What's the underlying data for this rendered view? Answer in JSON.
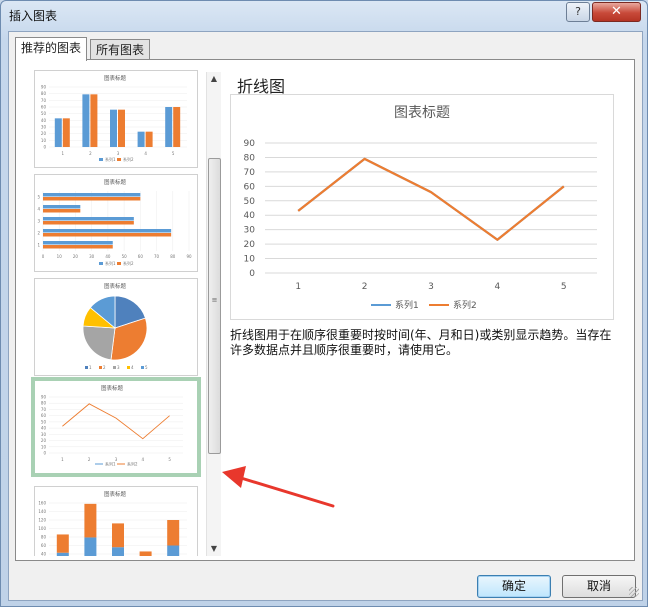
{
  "dialog": {
    "title": "插入图表",
    "help_label": "?",
    "close_label": "✕"
  },
  "tabs": [
    {
      "label": "推荐的图表",
      "active": true
    },
    {
      "label": "所有图表",
      "active": false
    }
  ],
  "thumbnails": [
    {
      "type": "clustered-column",
      "title": "图表标题",
      "y_ticks": [
        "0",
        "10",
        "20",
        "30",
        "40",
        "50",
        "60",
        "70",
        "80",
        "90"
      ],
      "categories": [
        "1",
        "2",
        "3",
        "4",
        "5"
      ],
      "series": [
        {
          "name": "系列1",
          "values": [
            43,
            79,
            56,
            23,
            60
          ]
        },
        {
          "name": "系列2",
          "values": [
            43,
            79,
            56,
            23,
            60
          ]
        }
      ],
      "legend": [
        "系列1",
        "系列2"
      ]
    },
    {
      "type": "clustered-bar",
      "title": "图表标题",
      "x_ticks": [
        "0",
        "10",
        "20",
        "30",
        "40",
        "50",
        "60",
        "70",
        "80",
        "90"
      ],
      "categories": [
        "1",
        "2",
        "3",
        "4",
        "5"
      ],
      "series": [
        {
          "name": "系列1",
          "values": [
            43,
            79,
            56,
            23,
            60
          ]
        },
        {
          "name": "系列2",
          "values": [
            43,
            79,
            56,
            23,
            60
          ]
        }
      ],
      "legend": [
        "系列1",
        "系列2"
      ]
    },
    {
      "type": "pie",
      "title": "图表标题",
      "values": [
        20,
        32,
        24,
        10,
        14
      ],
      "colors": [
        "#4f81bd",
        "#ed7d31",
        "#a5a5a5",
        "#ffc000",
        "#5b9bd5"
      ],
      "legend": [
        "1",
        "2",
        "3",
        "4",
        "5"
      ]
    },
    {
      "type": "line",
      "title": "图表标题",
      "y_ticks": [
        "0",
        "10",
        "20",
        "30",
        "40",
        "50",
        "60",
        "70",
        "80",
        "90"
      ],
      "categories": [
        "1",
        "2",
        "3",
        "4",
        "5"
      ],
      "values": [
        43,
        79,
        56,
        23,
        60
      ],
      "legend": [
        "系列1",
        "系列2"
      ],
      "selected": true
    },
    {
      "type": "stacked-column",
      "title": "图表标题",
      "y_ticks": [
        "0",
        "20",
        "40",
        "60",
        "80",
        "100",
        "120",
        "140",
        "160"
      ],
      "categories": [
        "1",
        "2",
        "3",
        "4",
        "5"
      ],
      "series": [
        {
          "name": "系列1",
          "values": [
            43,
            79,
            56,
            23,
            60
          ]
        },
        {
          "name": "系列2",
          "values": [
            43,
            79,
            56,
            23,
            60
          ]
        }
      ]
    }
  ],
  "preview": {
    "heading": "折线图",
    "description": "折线图用于在顺序很重要时按时间(年、月和日)或类别显示趋势。当存在许多数据点并且顺序很重要时，请使用它。"
  },
  "chart_data": {
    "type": "line",
    "title": "图表标题",
    "categories": [
      "1",
      "2",
      "3",
      "4",
      "5"
    ],
    "y_ticks": [
      "0",
      "10",
      "20",
      "30",
      "40",
      "50",
      "60",
      "70",
      "80",
      "90"
    ],
    "ylim": [
      0,
      90
    ],
    "grid": true,
    "legend_position": "bottom",
    "series": [
      {
        "name": "系列1",
        "color": "#5b9bd5",
        "values": [
          43,
          79,
          56,
          23,
          60
        ]
      },
      {
        "name": "系列2",
        "color": "#ed7d31",
        "values": [
          43,
          79,
          56,
          23,
          60
        ]
      }
    ]
  },
  "buttons": {
    "ok": "确定",
    "cancel": "取消"
  },
  "colors": {
    "series1": "#5b9bd5",
    "series2": "#ed7d31",
    "selection_border": "#a9d1b4",
    "arrow": "#e8372c"
  },
  "scrollbar": {
    "up_icon": "▲",
    "down_icon": "▼",
    "grip": "≡"
  }
}
